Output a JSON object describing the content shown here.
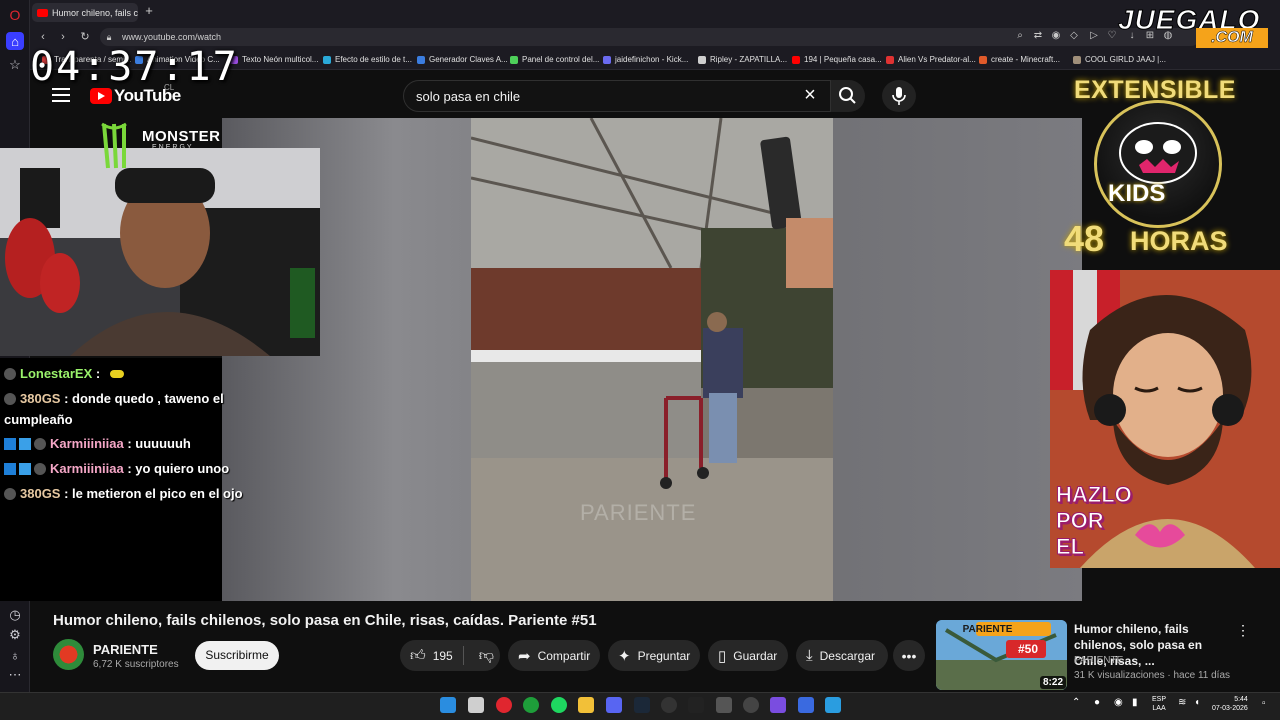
{
  "browser": {
    "tab_title": "Humor chileno, fails ch",
    "url": "www.youtube.com/watch",
    "bookmarks": [
      "Transparenta / semi...",
      "Animation Video C...",
      "Texto Neón multicol...",
      "Efecto de estilo de t...",
      "Generador Claves A...",
      "Panel de control del...",
      "jaidefinichon - Kick...",
      "Ripley - ZAPATILLA...",
      "194 | Pequeña casa...",
      "Alien Vs Predator-al...",
      "create - Minecraft...",
      "COOL GIRLD JAAJ |..."
    ]
  },
  "overlay": {
    "clock": "04:37:17",
    "monster_brand": "MONSTER",
    "monster_sub": "ENERGY",
    "extensible": "EXTENSIBLE",
    "kids": "KIDS",
    "hours_num": "48",
    "hours_label": "HORAS",
    "hazlo": "HAZLO POR EL",
    "juegalo": "JUEGALO",
    "juegalo_com": ".COM"
  },
  "youtube": {
    "logo_text": "YouTube",
    "country": "CL",
    "search_query": "solo pasa en chile",
    "video_watermark": "PARIENTE",
    "video_title": "Humor chileno, fails chilenos, solo pasa en Chile, risas, caídas. Pariente #51",
    "channel_name": "PARIENTE",
    "subscribers": "6,72 K suscriptores",
    "subscribe_label": "Suscribirme",
    "likes": "195",
    "share_label": "Compartir",
    "ask_label": "Preguntar",
    "save_label": "Guardar",
    "download_label": "Descargar",
    "more_label": "•••"
  },
  "chat": [
    {
      "user": "LonestarEX",
      "msg": ""
    },
    {
      "user": "380GS",
      "msg": "donde quedo , taweno el"
    },
    {
      "user": "",
      "msg": "cumpleaño"
    },
    {
      "user": "Karmiiiniiaa",
      "msg": "uuuuuuh"
    },
    {
      "user": "Karmiiiniiaa",
      "msg": "yo quiero unoo"
    },
    {
      "user": "380GS",
      "msg": "le metieron el pico en el ojo"
    }
  ],
  "recommendation": {
    "badge": "PARIENTE",
    "episode": "#50",
    "duration": "8:22",
    "title": "Humor chileno, fails chilenos, solo pasa en Chile, risas, ...",
    "channel": "PARIENTE",
    "meta": "31 K visualizaciones · hace 11 días"
  },
  "taskbar": {
    "lang_1": "ESP",
    "lang_2": "LAA",
    "time": "5:44",
    "date": "07-03-2026"
  },
  "colors": {
    "youtube_red": "#ff0000",
    "gold": "#f1dc7a",
    "juegalo_orange": "#f5a31a"
  }
}
